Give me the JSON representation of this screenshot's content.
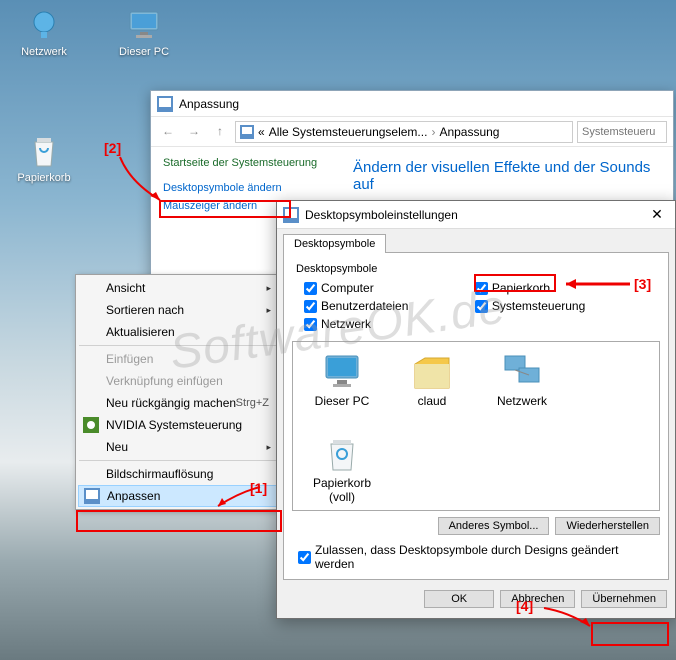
{
  "desktop": {
    "icons": [
      {
        "label": "Netzwerk"
      },
      {
        "label": "Dieser PC"
      },
      {
        "label": "Papierkorb"
      }
    ]
  },
  "personalization_window": {
    "title": "Anpassung",
    "breadcrumb_prefix": "«",
    "breadcrumb_1": "Alle Systemsteuerungselem...",
    "breadcrumb_2": "Anpassung",
    "search_placeholder": "Systemsteueru",
    "left_header": "Startseite der Systemsteuerung",
    "link_desktop_icons": "Desktopsymbole ändern",
    "link_mouse": "Mauszeiger ändern",
    "heading": "Ändern der visuellen Effekte und der Sounds auf"
  },
  "context_menu": {
    "items": [
      {
        "label": "Ansicht",
        "sub": true
      },
      {
        "label": "Sortieren nach",
        "sub": true
      },
      {
        "label": "Aktualisieren"
      },
      {
        "sep": true
      },
      {
        "label": "Einfügen",
        "disabled": true
      },
      {
        "label": "Verknüpfung einfügen",
        "disabled": true
      },
      {
        "label": "Neu rückgängig machen",
        "kb": "Strg+Z"
      },
      {
        "label": "NVIDIA Systemsteuerung",
        "icon": "nvidia"
      },
      {
        "label": "Neu",
        "sub": true
      },
      {
        "sep": true
      },
      {
        "label": "Bildschirmauflösung"
      },
      {
        "label": "Anpassen",
        "icon": "personalize",
        "selected": true
      }
    ]
  },
  "dlg": {
    "title": "Desktopsymboleinstellungen",
    "tab": "Desktopsymbole",
    "group": "Desktopsymbole",
    "chk_computer": "Computer",
    "chk_userfiles": "Benutzerdateien",
    "chk_network": "Netzwerk",
    "chk_recycle": "Papierkorb",
    "chk_control": "Systemsteuerung",
    "icons": {
      "thispc": "Dieser PC",
      "user": "claud",
      "network": "Netzwerk",
      "recycle_full": "Papierkorb (voll)"
    },
    "btn_other": "Anderes Symbol...",
    "btn_restore": "Wiederherstellen",
    "chk_themes": "Zulassen, dass Desktopsymbole durch Designs geändert werden",
    "btn_ok": "OK",
    "btn_cancel": "Abbrechen",
    "btn_apply": "Übernehmen"
  },
  "callouts": {
    "c1": "[1]",
    "c2": "[2]",
    "c3": "[3]",
    "c4": "[4]"
  },
  "watermark": "SoftwareOK.de"
}
